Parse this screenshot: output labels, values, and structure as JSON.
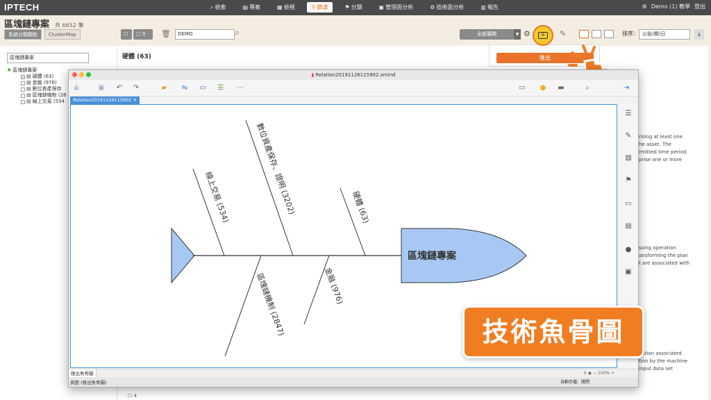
{
  "app": {
    "logo": "IPTECH"
  },
  "nav": {
    "items": [
      {
        "label": "檢索",
        "icon": "⌕"
      },
      {
        "label": "專案",
        "icon": "▤"
      },
      {
        "label": "檢視",
        "icon": "▦"
      },
      {
        "label": "篩選",
        "icon": "⚲"
      },
      {
        "label": "分類",
        "icon": "⚑"
      },
      {
        "label": "管理面分析",
        "icon": "▣"
      },
      {
        "label": "技術面分析",
        "icon": "⚙"
      },
      {
        "label": "報告",
        "icon": "▥"
      }
    ],
    "active_index": 3,
    "user": "Demo (1) 教學",
    "logout": "登出"
  },
  "header": {
    "title": "區塊鏈專案",
    "count": "共 6652 筆"
  },
  "toolbar": {
    "view_tabs": [
      "系統分類觀點",
      "ClusterMap"
    ],
    "selected_count": "0",
    "search_value": "DEMO",
    "expand_all": "全部展開",
    "sort_label": "排序：",
    "sort_value": "公告(開)日"
  },
  "left": {
    "select": "區塊鏈專案",
    "tree_root": "區塊鏈專案",
    "tree_items": [
      "硬體 (63)",
      "金融 (976)",
      "數位資產保存",
      "區塊鏈機制 (28",
      "線上交易 (534"
    ]
  },
  "main": {
    "heading": "硬體 (63)",
    "side_text_1": [
      "rising at least one",
      "he asset. The",
      "rmitted time period.",
      "prise one or more"
    ],
    "side_text_2": [
      "ssing operation",
      "ansforming the plan",
      "t are associated with"
    ],
    "side_text_3": [
      "nation associated",
      "tion by the machine",
      "input data set"
    ],
    "bottom_index": "4"
  },
  "export": {
    "label": "匯出"
  },
  "xmind": {
    "file_title": "Relation20191126115902.xmind",
    "tab": "Relation20191126115902",
    "sheet_tab": "匯出魚骨圖",
    "zoom": "150%",
    "status_left": "頁面 (匯出魚骨圖)",
    "status_right": "自動存檔：關閉"
  },
  "fishbone": {
    "head": "區塊鏈專案",
    "bones": [
      {
        "label": "線上交易 (534)"
      },
      {
        "label": "數位資產保存、證明 (3202)"
      },
      {
        "label": "硬體 (63)"
      },
      {
        "label": "區塊鏈機制 (2847)"
      },
      {
        "label": "金融 (976)"
      }
    ]
  },
  "caption": "技術魚骨圖",
  "colors": {
    "accent": "#e9742a",
    "nav_bg": "#4a4a4a",
    "fish": "#a7c8f2",
    "tab_blue": "#4a90d9"
  }
}
